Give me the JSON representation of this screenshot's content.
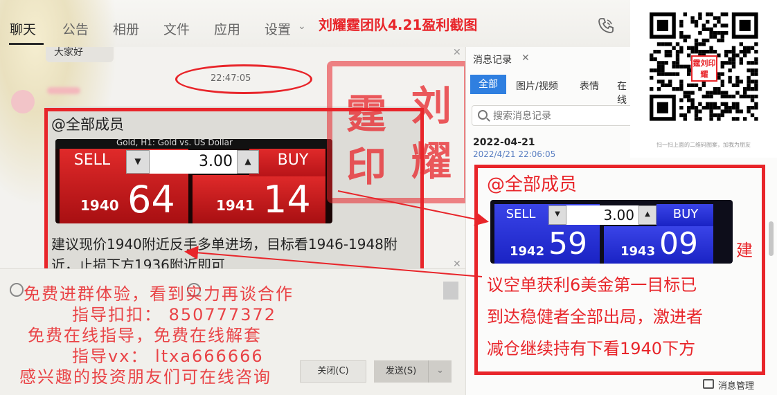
{
  "nav": {
    "tabs": [
      {
        "label": "聊天",
        "active": true
      },
      {
        "label": "公告"
      },
      {
        "label": "相册"
      },
      {
        "label": "文件"
      },
      {
        "label": "应用"
      },
      {
        "label": "设置"
      }
    ],
    "title": "刘耀霆团队4.21盈利截图"
  },
  "chat": {
    "prev_bubble_text": "大家好",
    "timestamp": "22:47:05",
    "mention": "@全部成员",
    "widget_header": "Gold, H1:  Gold vs. US Dollar",
    "widget": {
      "sell_label": "SELL",
      "buy_label": "BUY",
      "qty": "3.00",
      "sell_small": "1940",
      "sell_big": "64",
      "buy_small": "1941",
      "buy_big": "14"
    },
    "message": "建议现价1940附近反手多单进场，目标看1946-1948附近，止损下方1936附近即可",
    "stamp_chars": [
      "刘",
      "霆",
      "耀",
      "印"
    ]
  },
  "input": {
    "ad_lines": [
      "免费进群体验，看到实力再谈合作",
      "指导扣扣：  850777372",
      "免费在线指导，免费在线解套",
      "指导vx：    ltxa666666",
      "感兴趣的投资朋友们可在线咨询"
    ],
    "close_label": "关闭(C)",
    "send_label": "发送(S)"
  },
  "panel": {
    "title": "消息记录",
    "tabs": [
      "全部",
      "图片/视频",
      "表情",
      "在线"
    ],
    "search_placeholder": "搜索消息记录",
    "date": "2022-04-21",
    "sub_stamp": "2022/4/21 22:06:05",
    "mention": "@全部成员",
    "widget": {
      "sell_label": "SELL",
      "buy_label": "BUY",
      "qty": "3.00",
      "sell_small": "1942",
      "sell_big": "59",
      "buy_small": "1943",
      "buy_big": "09"
    },
    "right_lines": [
      "建",
      "议空单获利6美金第一目标已",
      "到达稳健者全部出局，激进者",
      "减仓继续持有下看1940下方"
    ],
    "msg_mgmt": "消息管理"
  },
  "qr": {
    "caption": "扫一扫上面的二维码图案，加我为朋友",
    "seal": "霆刘印耀"
  },
  "colors": {
    "accent_red": "#e8252a",
    "sell_red": "#c4161c",
    "buy_blue": "#1a23c4",
    "tab_blue": "#2f7fe0"
  }
}
